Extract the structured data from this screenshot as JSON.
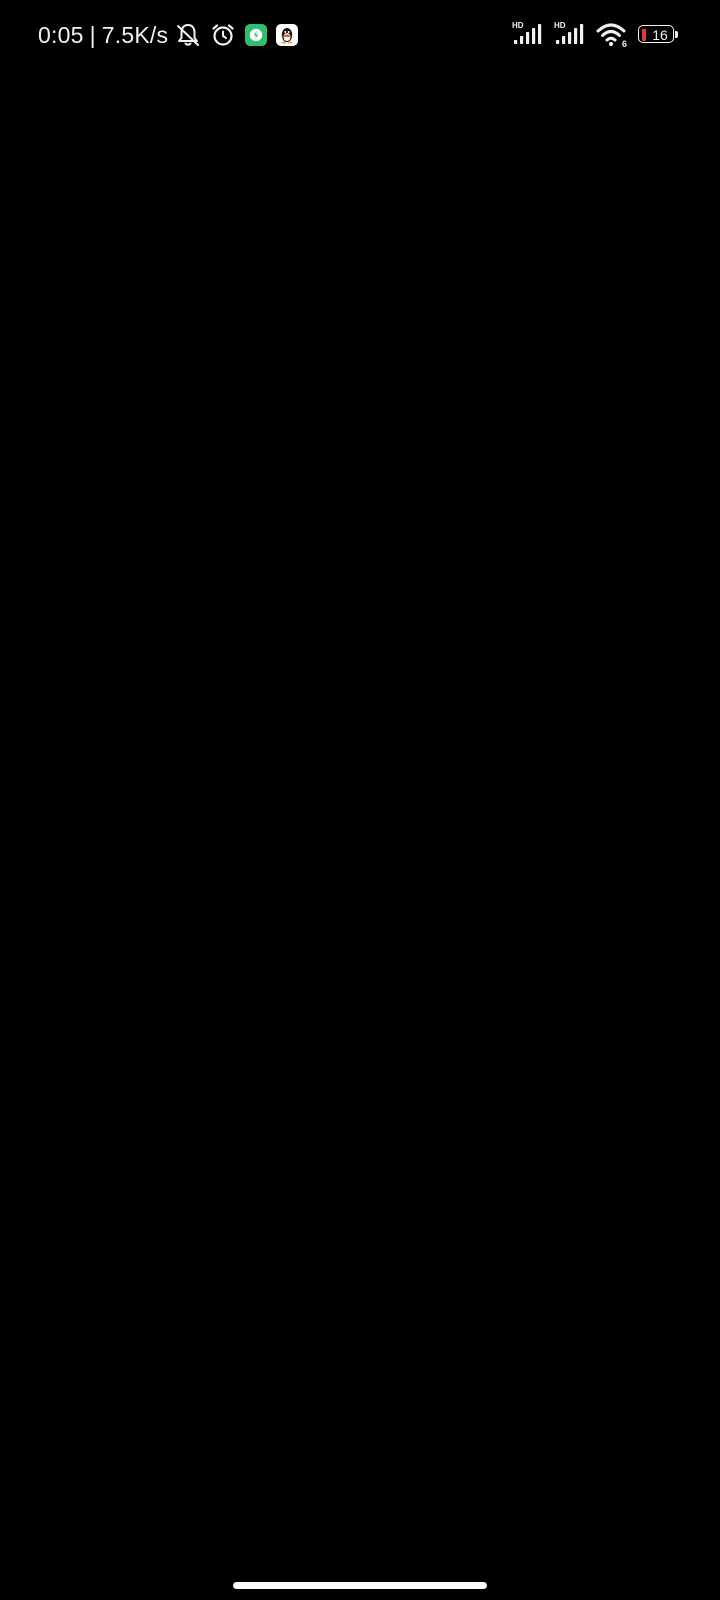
{
  "status_bar": {
    "time": "0:05",
    "separator": "|",
    "network_speed": "7.5K/s",
    "left_icons": [
      "bell-muted-icon",
      "alarm-icon",
      "green-shield-app-icon",
      "qq-penguin-icon"
    ],
    "sim1_label": "HD",
    "sim2_label": "HD",
    "wifi_label": "6",
    "battery_level": "16",
    "battery_fill_color": "#e53935",
    "app_icon_green": "#2fbf71"
  },
  "screen": {
    "background": "#000000"
  },
  "navigation": {
    "home_indicator": "gesture-bar"
  }
}
